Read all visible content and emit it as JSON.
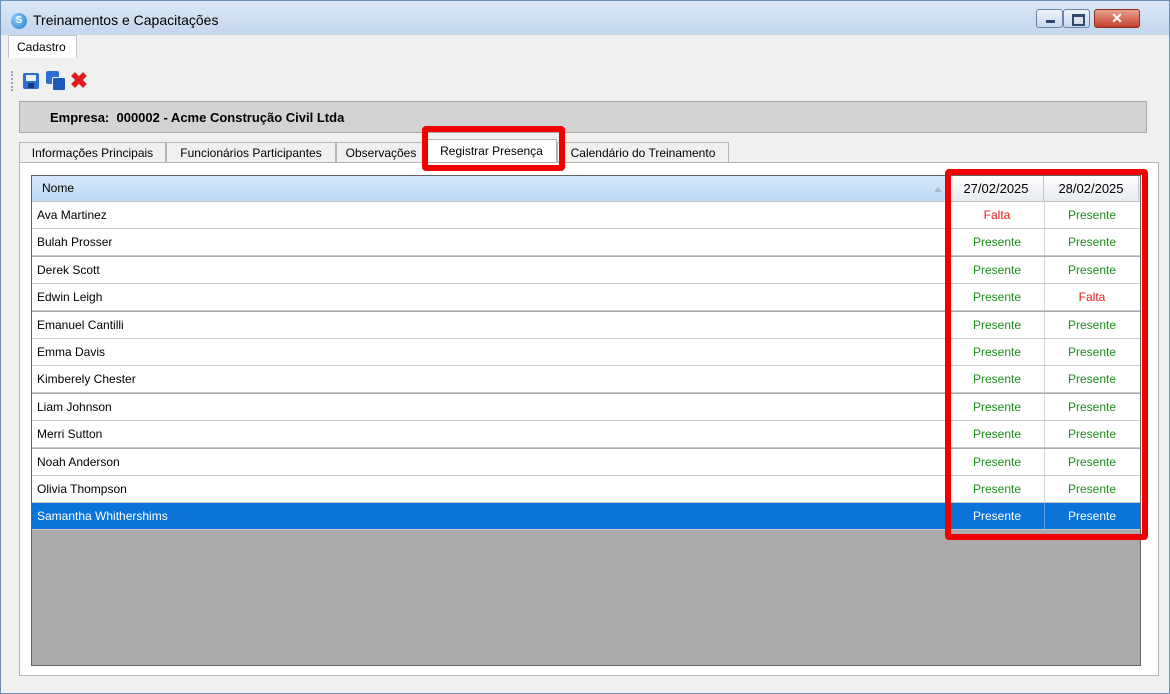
{
  "window": {
    "title": "Treinamentos e Capacitações",
    "minimize_label": "minimize",
    "maximize_label": "maximize",
    "close_glyph": "✕"
  },
  "menu": {
    "cadastro": "Cadastro"
  },
  "toolbar": {
    "icons": [
      "save-icon",
      "save-all-icon",
      "delete-icon"
    ],
    "delete_glyph": "✖"
  },
  "empresa": {
    "label": "Empresa:",
    "value": "000002 - Acme Construção Civil Ltda"
  },
  "tabs": [
    {
      "label": "Informações Principais"
    },
    {
      "label": "Funcionários Participantes"
    },
    {
      "label": "Observações"
    },
    {
      "label": "Registrar Presença"
    },
    {
      "label": "Calendário do Treinamento"
    }
  ],
  "active_tab": "Registrar Presença",
  "grid": {
    "columns": [
      "Nome",
      "27/02/2025",
      "28/02/2025"
    ],
    "rows": [
      {
        "nome": "Ava Martinez",
        "d1": "Falta",
        "d2": "Presente"
      },
      {
        "nome": "Bulah Prosser",
        "d1": "Presente",
        "d2": "Presente"
      },
      {
        "nome": "Derek Scott",
        "d1": "Presente",
        "d2": "Presente"
      },
      {
        "nome": "Edwin Leigh",
        "d1": "Presente",
        "d2": "Falta"
      },
      {
        "nome": "Emanuel Cantilli",
        "d1": "Presente",
        "d2": "Presente"
      },
      {
        "nome": "Emma Davis",
        "d1": "Presente",
        "d2": "Presente"
      },
      {
        "nome": "Kimberely Chester",
        "d1": "Presente",
        "d2": "Presente"
      },
      {
        "nome": "Liam Johnson",
        "d1": "Presente",
        "d2": "Presente"
      },
      {
        "nome": "Merri Sutton",
        "d1": "Presente",
        "d2": "Presente"
      },
      {
        "nome": "Noah Anderson",
        "d1": "Presente",
        "d2": "Presente"
      },
      {
        "nome": "Olivia Thompson",
        "d1": "Presente",
        "d2": "Presente"
      },
      {
        "nome": "Samantha Whithershims",
        "d1": "Presente",
        "d2": "Presente"
      }
    ],
    "selected_row": "Samantha Whithershims"
  },
  "colors": {
    "presente": "#1c8f1c",
    "falta": "#e11c1c",
    "selection": "#0a74d8",
    "highlight": "#f20000"
  }
}
